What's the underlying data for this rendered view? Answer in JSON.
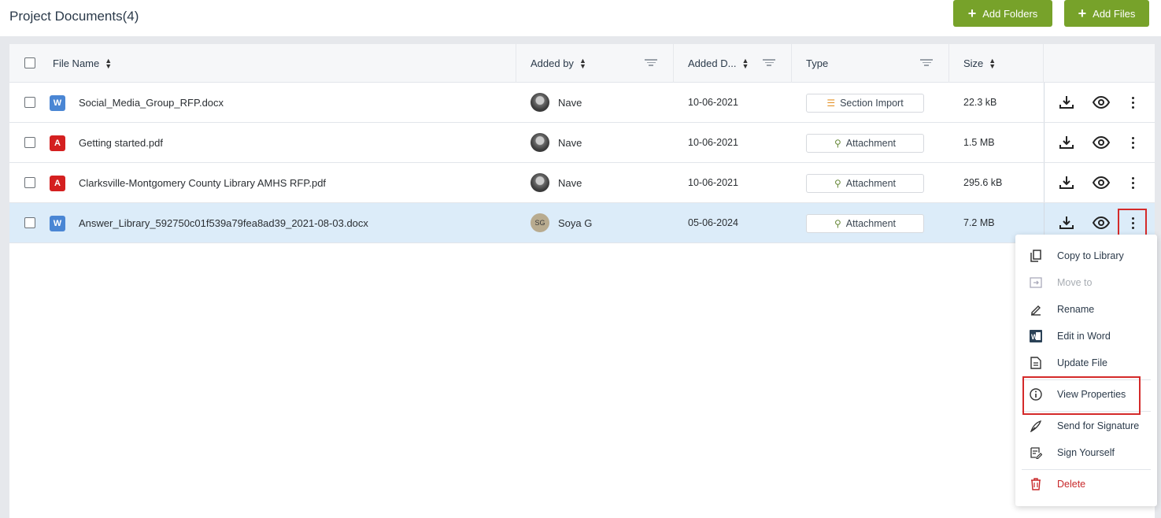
{
  "header": {
    "title": "Project Documents(4)",
    "add_folders_label": "Add Folders",
    "add_files_label": "Add Files",
    "accent_color": "#77a22a"
  },
  "table": {
    "columns": {
      "file_name": "File Name",
      "added_by": "Added by",
      "added_date": "Added D...",
      "type": "Type",
      "size": "Size"
    },
    "rows": [
      {
        "icon": "word-file-icon",
        "file_name": "Social_Media_Group_RFP.docx",
        "avatar": "photo",
        "added_by": "Nave",
        "added_date": "10-06-2021",
        "type": "Section Import",
        "size": "22.3 kB"
      },
      {
        "icon": "pdf-file-icon",
        "file_name": "Getting started.pdf",
        "avatar": "photo",
        "added_by": "Nave",
        "added_date": "10-06-2021",
        "type": "Attachment",
        "size": "1.5 MB"
      },
      {
        "icon": "pdf-file-icon",
        "file_name": "Clarksville-Montgomery County Library AMHS RFP.pdf",
        "avatar": "photo",
        "added_by": "Nave",
        "added_date": "10-06-2021",
        "type": "Attachment",
        "size": "295.6 kB"
      },
      {
        "icon": "word-file-icon",
        "file_name": "Answer_Library_592750c01f539a79fea8ad39_2021-08-03.docx",
        "avatar_initials": "SG",
        "added_by": "Soya G",
        "added_date": "05-06-2024",
        "type": "Attachment",
        "size": "7.2 MB"
      }
    ]
  },
  "context_menu": {
    "items": [
      {
        "label": "Copy to Library",
        "icon": "copy-icon"
      },
      {
        "label": "Move to",
        "icon": "move-icon",
        "disabled": true
      },
      {
        "label": "Rename",
        "icon": "pencil-icon"
      },
      {
        "label": "Edit in Word",
        "icon": "word-icon"
      },
      {
        "label": "Update File",
        "icon": "document-icon"
      },
      {
        "label": "View Properties",
        "icon": "info-icon"
      },
      {
        "label": "Send for Signature",
        "icon": "pen-nib-icon"
      },
      {
        "label": "Sign Yourself",
        "icon": "sign-edit-icon"
      },
      {
        "label": "Delete",
        "icon": "trash-icon",
        "danger": true
      }
    ]
  }
}
